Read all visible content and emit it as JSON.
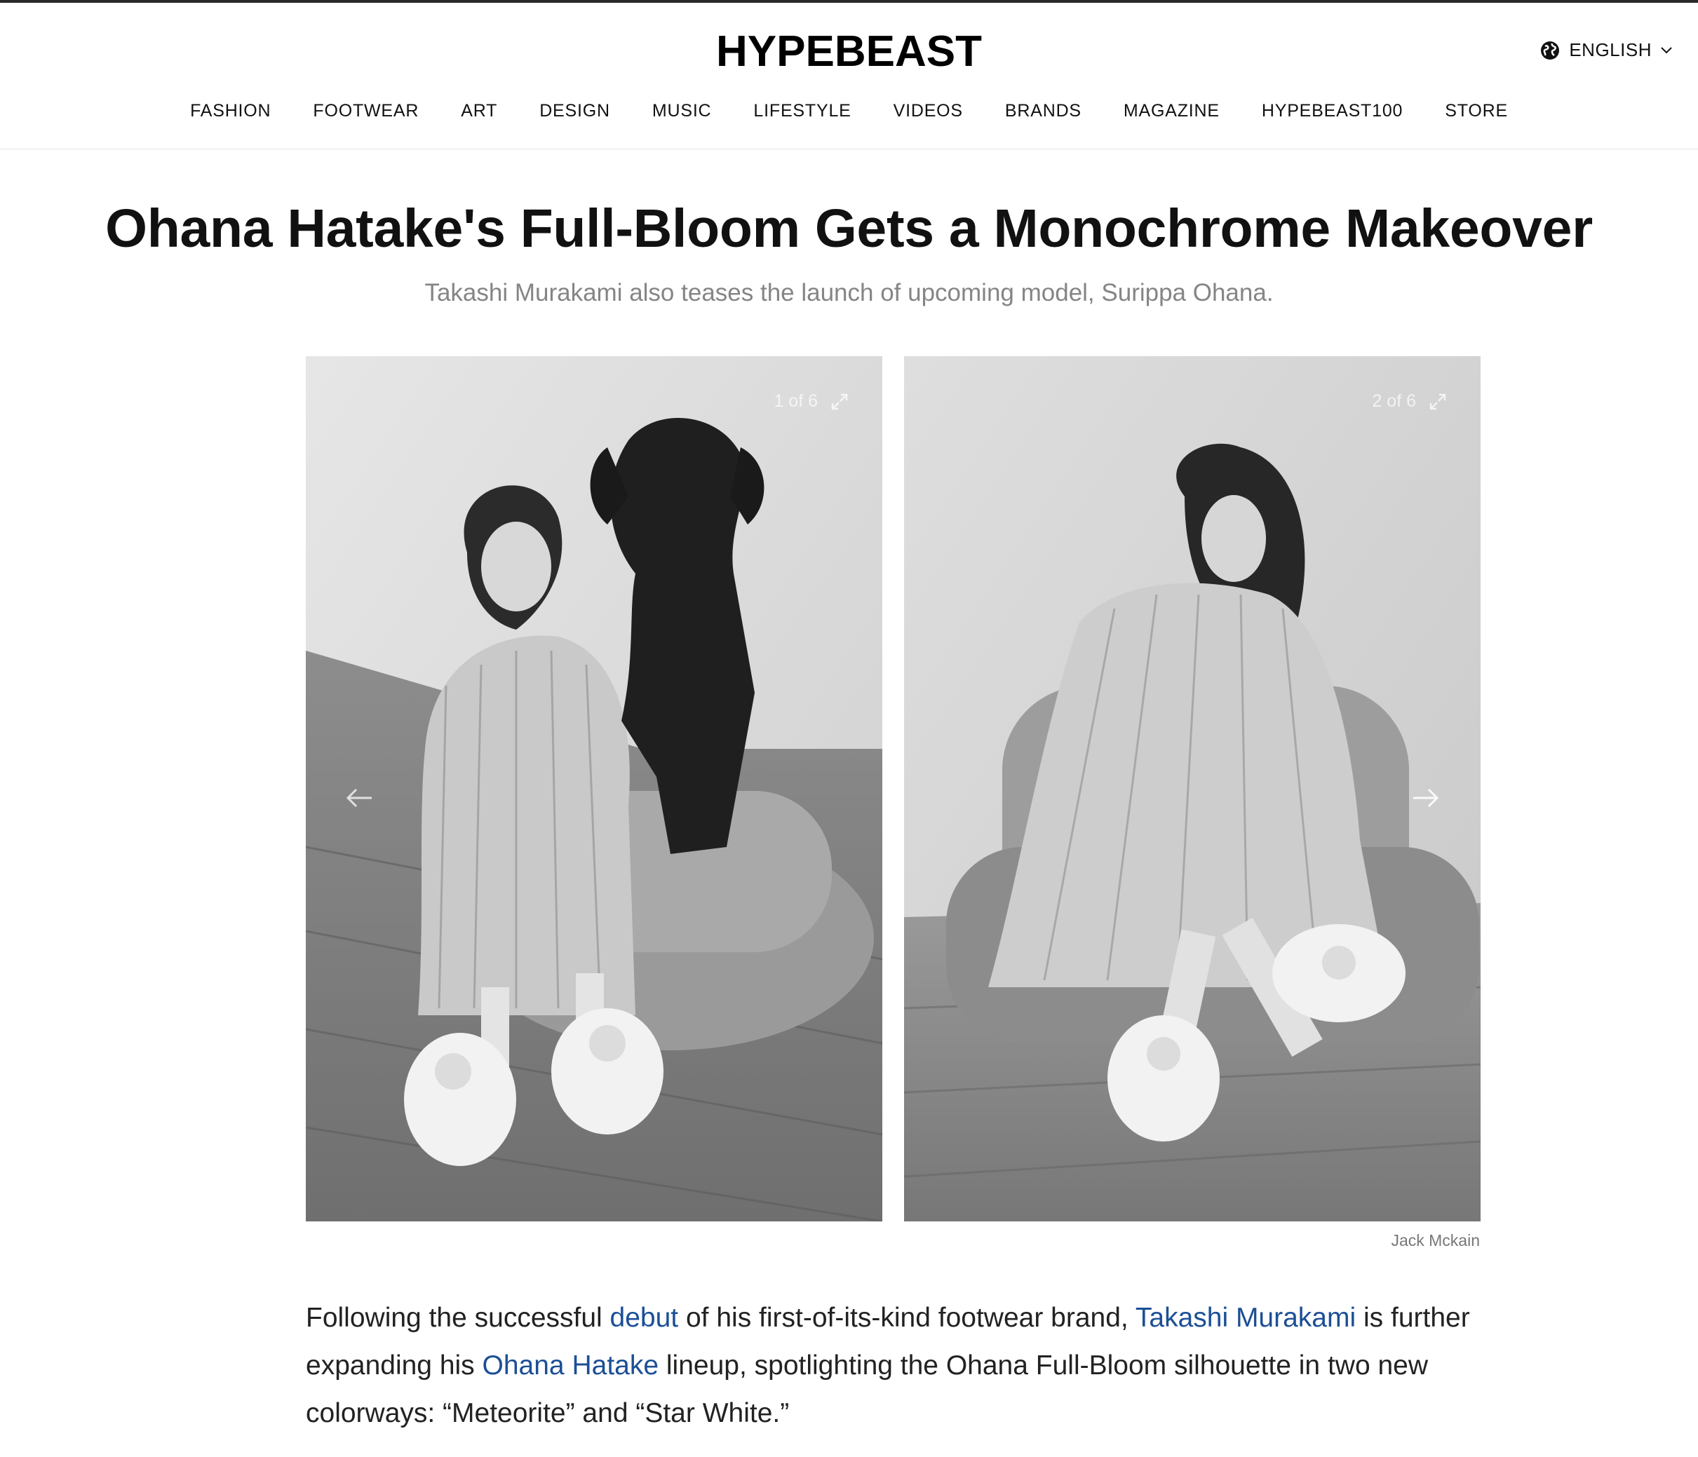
{
  "header": {
    "logo": "HYPEBEAST",
    "language": "ENGLISH",
    "language_icon": "globe-icon",
    "language_chevron": "chevron-down-icon"
  },
  "nav": {
    "items": [
      "FASHION",
      "FOOTWEAR",
      "ART",
      "DESIGN",
      "MUSIC",
      "LIFESTYLE",
      "VIDEOS",
      "BRANDS",
      "MAGAZINE",
      "HYPEBEAST100",
      "STORE"
    ]
  },
  "article": {
    "title": "Ohana Hatake's Full-Bloom Gets a Monochrome Makeover",
    "subtitle": "Takashi Murakami also teases the launch of upcoming model, Surippa Ohana."
  },
  "gallery": {
    "slides": [
      {
        "counter": "1 of 6",
        "alt": "Woman with dog seated on a sofa wearing Ohana Full-Bloom slides"
      },
      {
        "counter": "2 of 6",
        "alt": "Woman seated in armchair wearing Ohana Full-Bloom slides"
      }
    ],
    "expand_icon": "expand-icon",
    "prev_icon": "arrow-left-icon",
    "next_icon": "arrow-right-icon",
    "credit": "Jack Mckain"
  },
  "body": {
    "p1_a": "Following the successful ",
    "link_debut": "debut",
    "p1_b": " of his first-of-its-kind footwear brand, ",
    "link_murakami": "Takashi Murakami",
    "p1_c": " is further expanding his ",
    "link_ohana": "Ohana Hatake",
    "p1_d": " lineup, spotlighting the Ohana Full-Bloom silhouette in two new colorways: “Meteorite” and “Star White.”"
  },
  "colors": {
    "link": "#1c4f96",
    "subtitle": "#858585",
    "credit": "#777777"
  }
}
